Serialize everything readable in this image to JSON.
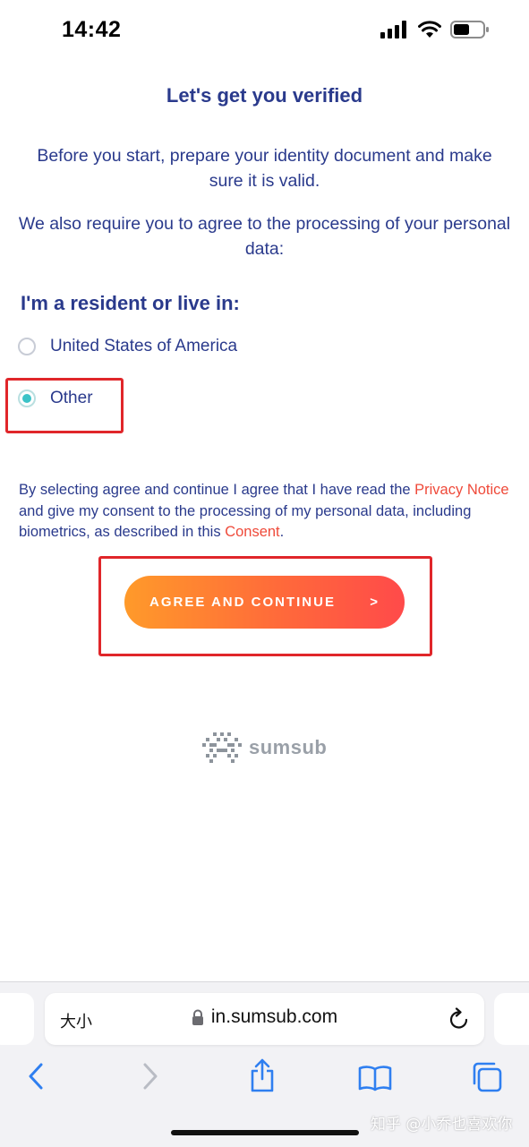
{
  "status_bar": {
    "time": "14:42"
  },
  "page": {
    "title": "Let's get you verified",
    "intro_1": "Before you start, prepare your identity document and make sure it is valid.",
    "intro_2": "We also require you to agree to the processing of your personal data:",
    "residence_label": "I'm a resident or live in:",
    "options": [
      {
        "label": "United States of America",
        "selected": false
      },
      {
        "label": "Other",
        "selected": true
      }
    ],
    "consent": {
      "part1": "By selecting agree and continue I agree that I have read the ",
      "privacy_link": "Privacy Notice",
      "part2": " and give my consent to the processing of my personal data, including biometrics, as described in this ",
      "consent_link": "Consent",
      "part3": "."
    },
    "agree_button": {
      "label": "AGREE AND CONTINUE",
      "arrow": ">"
    },
    "logo_text": "sumsub"
  },
  "browser": {
    "text_size_label": "大小",
    "url": "in.sumsub.com",
    "toolbar": [
      "back-icon",
      "forward-icon",
      "share-icon",
      "bookmarks-icon",
      "tabs-icon"
    ]
  },
  "watermark": "知乎 @小乔也喜欢你",
  "colors": {
    "accent_text": "#2a3a8c",
    "link": "#ef4a3a",
    "radio_selected": "#3cc3c7",
    "button_gradient_start": "#ff9a2a",
    "button_gradient_end": "#ff4a4a",
    "highlight": "#e0262a"
  }
}
